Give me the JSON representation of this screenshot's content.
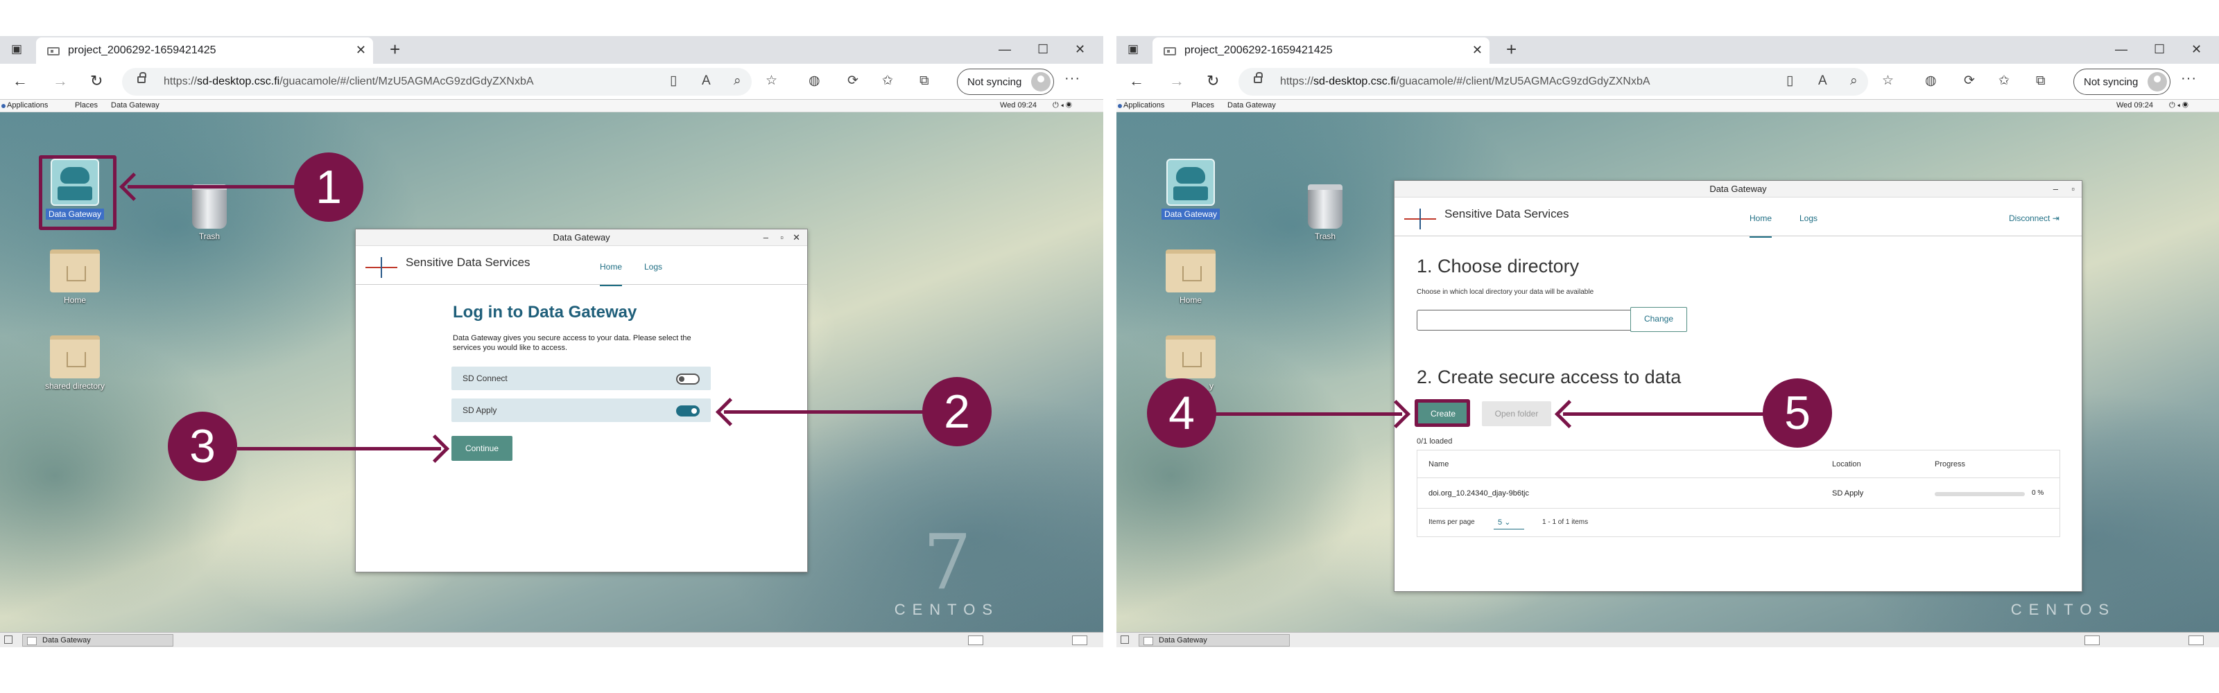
{
  "browser": {
    "tab_title": "project_2006292-1659421425",
    "url_prefix": "https://",
    "url_host": "sd-desktop.csc.fi",
    "url_path": "/guacamole/#/client/MzU5AGMAcG9zdGdyZXNxbA",
    "not_syncing": "Not syncing"
  },
  "gnome": {
    "applications": "Applications",
    "places": "Places",
    "data_gateway_menu": "Data Gateway",
    "clock": "Wed 09:24"
  },
  "desktop": {
    "icons": {
      "data_gateway": "Data Gateway",
      "trash": "Trash",
      "home": "Home",
      "shared_directory": "shared directory",
      "shared_directory_partial": "y"
    },
    "brand_number": "7",
    "brand_name": "CENTOS",
    "taskbar_item": "Data Gateway"
  },
  "left_app": {
    "window_title": "Data Gateway",
    "brand": "Sensitive Data Services",
    "nav_home": "Home",
    "nav_logs": "Logs",
    "heading": "Log in to Data Gateway",
    "description": "Data Gateway gives you secure access to your data. Please select the services you would like to access.",
    "services": [
      {
        "label": "SD Connect",
        "enabled": false
      },
      {
        "label": "SD Apply",
        "enabled": true
      }
    ],
    "continue_button": "Continue"
  },
  "right_app": {
    "window_title": "Data Gateway",
    "brand": "Sensitive Data Services",
    "nav_home": "Home",
    "nav_logs": "Logs",
    "disconnect": "Disconnect",
    "section1_title": "1. Choose directory",
    "section1_desc": "Choose in which local directory your data will be available",
    "directory_value": "",
    "change_button": "Change",
    "section2_title": "2. Create secure access to data",
    "create_button": "Create",
    "open_folder_button": "Open folder",
    "loaded_status": "0/1 loaded",
    "table_headers": {
      "name": "Name",
      "location": "Location",
      "progress": "Progress"
    },
    "table_rows": [
      {
        "name": "doi.org_10.24340_djay-9b6tjc",
        "location": "SD Apply",
        "progress": 0,
        "progress_label": "0 %"
      }
    ],
    "items_per_page_label": "Items per page",
    "items_per_page_value": "5",
    "pagination_range": "1 - 1 of 1 items"
  },
  "annotations": {
    "n1": "1",
    "n2": "2",
    "n3": "3",
    "n4": "4",
    "n5": "5",
    "color": "#7a1448"
  }
}
